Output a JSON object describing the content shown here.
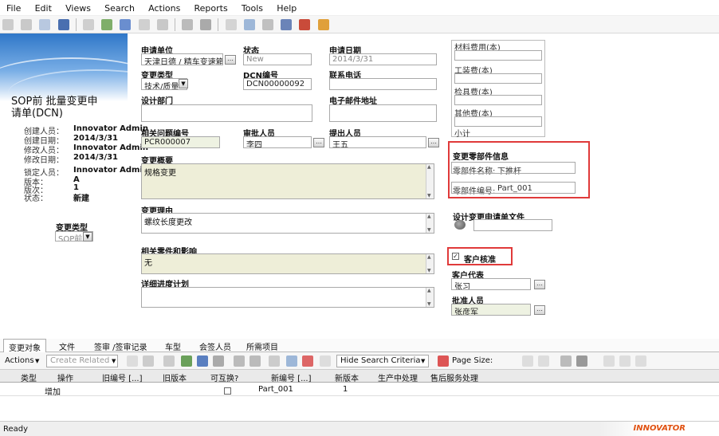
{
  "menu": [
    "File",
    "Edit",
    "Views",
    "Search",
    "Actions",
    "Reports",
    "Tools",
    "Help"
  ],
  "summary": {
    "title_line1": "SOP前 批量变更申",
    "title_line2": "请单(DCN)",
    "rows": [
      {
        "label": "创建人员：",
        "value": "Innovator Admin"
      },
      {
        "label": "创建日期：",
        "value": "2014/3/31"
      },
      {
        "label": "修改人员：",
        "value": "Innovator Admin"
      },
      {
        "label": "修改日期：",
        "value": "2014/3/31"
      },
      {
        "label": "锁定人员：",
        "value": "Innovator Admin"
      },
      {
        "label": "版本：",
        "value": "A"
      },
      {
        "label": "版次：",
        "value": "1"
      },
      {
        "label": "状态：",
        "value": "新建"
      }
    ]
  },
  "form": {
    "apply_unit_label": "申请单位",
    "apply_unit_value": "天津日德 / 精车变速箱",
    "status_label": "状态",
    "status_value": "New",
    "apply_date_label": "申请日期",
    "apply_date_value": "2014/3/31",
    "change_type_label": "变更类型",
    "change_type_value": "技术/质量",
    "dcn_no_label": "DCN编号",
    "dcn_no_value": "DCN00000092",
    "phone_label": "联系电话",
    "phone_value": "",
    "design_dept_label": "设计部门",
    "design_dept_value": "",
    "email_label": "电子邮件地址",
    "email_value": "",
    "related_no_label": "相关问题编号",
    "related_no_value": "PCR000007",
    "approver_label": "审批人员",
    "approver_value": "李四",
    "proposer_label": "提出人员",
    "proposer_value": "王五",
    "summary_label": "变更概要",
    "summary_value": "规格变更",
    "reason_label": "变更理由",
    "reason_value": "螺纹长度更改",
    "affected_label": "相关零件和影响",
    "affected_value": "无",
    "schedule_label": "详细进度计划",
    "schedule_value": "",
    "category_label": "变更类型",
    "category_value": "SOP前"
  },
  "costs": [
    {
      "label": "材料费用(本)",
      "value": ""
    },
    {
      "label": "工装费(本)",
      "value": ""
    },
    {
      "label": "检具费(本)",
      "value": ""
    },
    {
      "label": "其他费(本)",
      "value": ""
    },
    {
      "label": "小计",
      "value": ""
    }
  ],
  "part_info": {
    "title": "变更零部件信息",
    "name_label": "零部件名称:",
    "name_value": "下推杆",
    "no_label": "零部件编号:",
    "no_value": "Part_001"
  },
  "design_file_label": "设计变更申请单文件",
  "customer": {
    "check_label": "客户核准",
    "checked": true,
    "rep_label": "客户代表",
    "rep_value": "张习",
    "approver_label": "批准人员",
    "approver_value": "张彦军"
  },
  "tabs": [
    "变更对象",
    "文件",
    "签审 /签审记录",
    "车型",
    "会签人员",
    "所需项目"
  ],
  "grid_toolbar": {
    "actions": "Actions",
    "create_related": "Create Related",
    "hide_search": "Hide Search Criteria",
    "page_size": "Page Size:"
  },
  "grid": {
    "columns": [
      "类型",
      "操作",
      "旧编号 [...]",
      "旧版本",
      "可互换?",
      "新编号 [...]",
      "新版本",
      "生产中处理",
      "售后服务处理"
    ],
    "rows": [
      {
        "type": "",
        "action": "增加",
        "old_no": "",
        "old_ver": "",
        "interchangeable": false,
        "new_no": "Part_001",
        "new_ver": "1",
        "production": "",
        "service": ""
      }
    ]
  },
  "status": {
    "left": "Ready",
    "logo": "INNOVATOR"
  },
  "colors": {
    "highlight_border": "#e03a3a",
    "readonly_bg": "#eeeed8",
    "banner_blue": "#2f77c8"
  }
}
